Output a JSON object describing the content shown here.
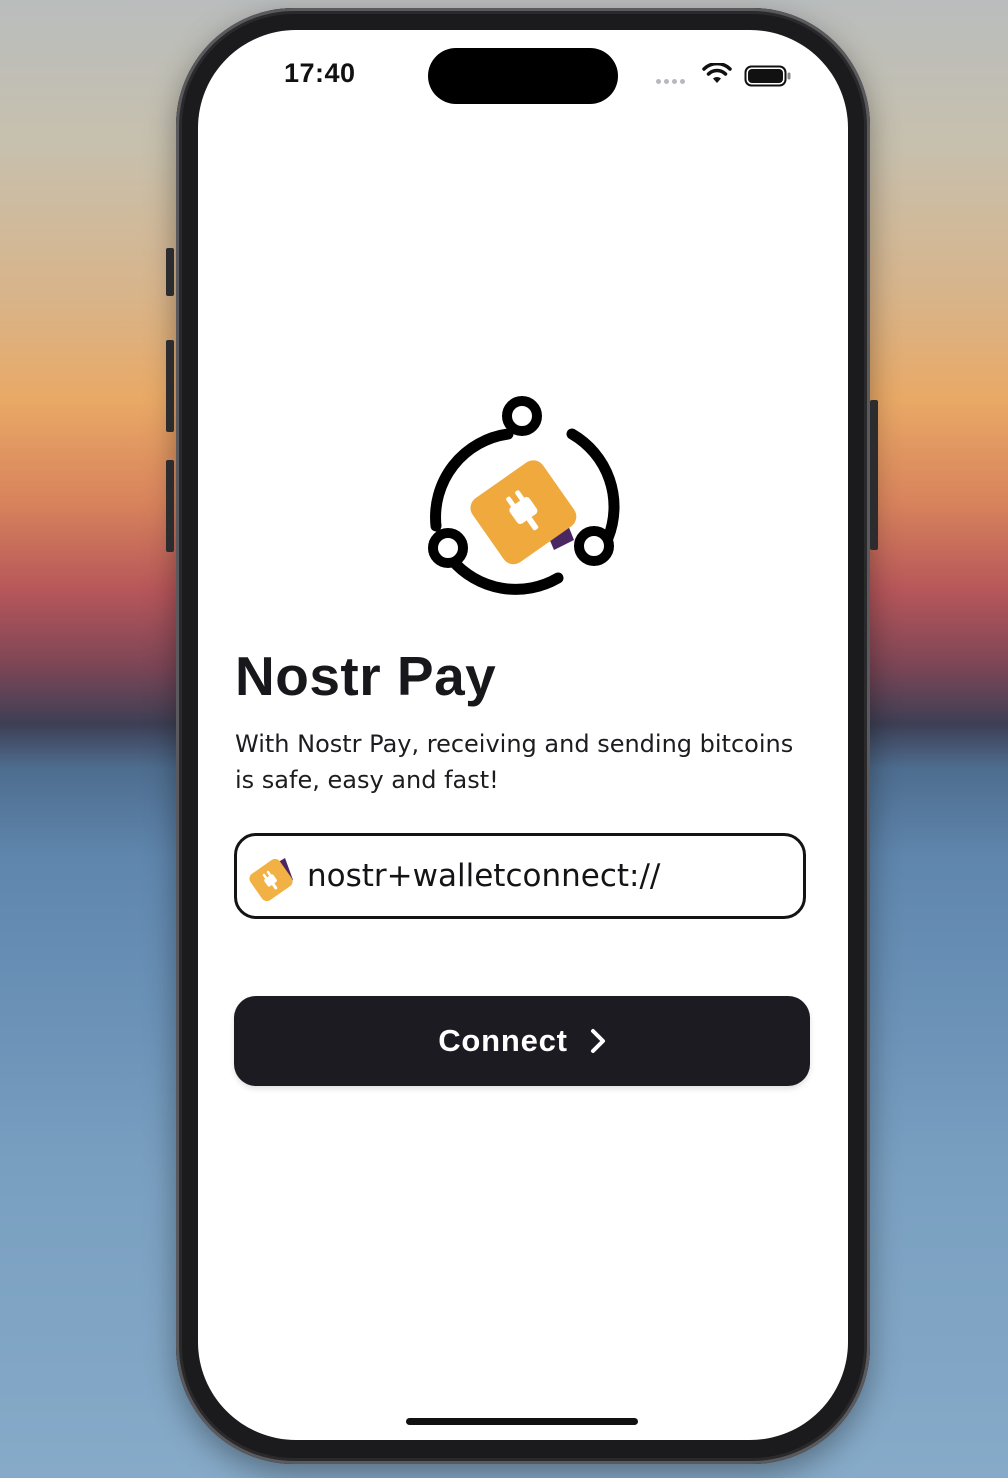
{
  "status_bar": {
    "time": "17:40"
  },
  "app": {
    "title": "Nostr Pay",
    "subtitle": "With Nostr Pay, receiving and sending bitcoins is safe, easy and fast!"
  },
  "connection_input": {
    "value": "nostr+walletconnect://",
    "icon": "nostr-wallet-icon"
  },
  "connect_button": {
    "label": "Connect",
    "icon": "chevron-right-icon"
  },
  "colors": {
    "primary": "#1b1b21",
    "accent_orange": "#f2a33a",
    "accent_purple": "#4a2760",
    "background": "#ffffff"
  }
}
